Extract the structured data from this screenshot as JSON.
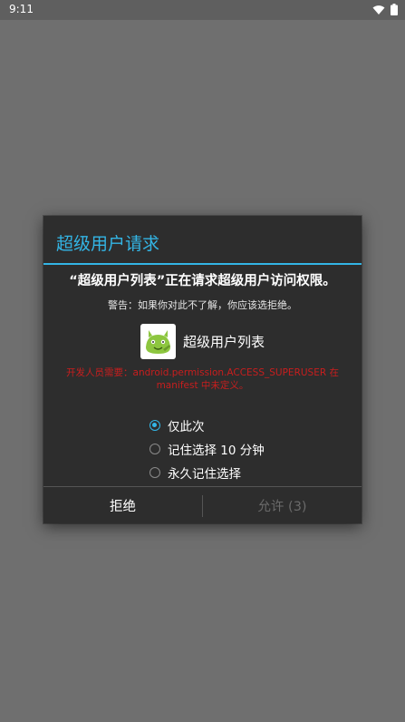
{
  "status_bar": {
    "time": "9:11",
    "icons": [
      "wifi-icon",
      "battery-icon"
    ]
  },
  "dialog": {
    "title": "超级用户请求",
    "message": "“超级用户列表”正在请求超级用户访问权限。",
    "warning": "警告：如果你对此不了解，你应该选拒绝。",
    "app": {
      "name": "超级用户列表",
      "icon": "superuser-app-icon"
    },
    "dev_error": "开发人员需要：android.permission.ACCESS_SUPERUSER 在 manifest 中未定义。",
    "options": [
      {
        "label": "仅此次",
        "checked": true
      },
      {
        "label": "记住选择 10 分钟",
        "checked": false
      },
      {
        "label": "永久记住选择",
        "checked": false
      }
    ],
    "buttons": {
      "deny": "拒绝",
      "allow": "允许 (3)"
    }
  },
  "colors": {
    "accent": "#33b5e5",
    "error": "#c81e1e",
    "background_dim": "#6f6f6f",
    "dialog_bg": "#2d2d2d"
  }
}
